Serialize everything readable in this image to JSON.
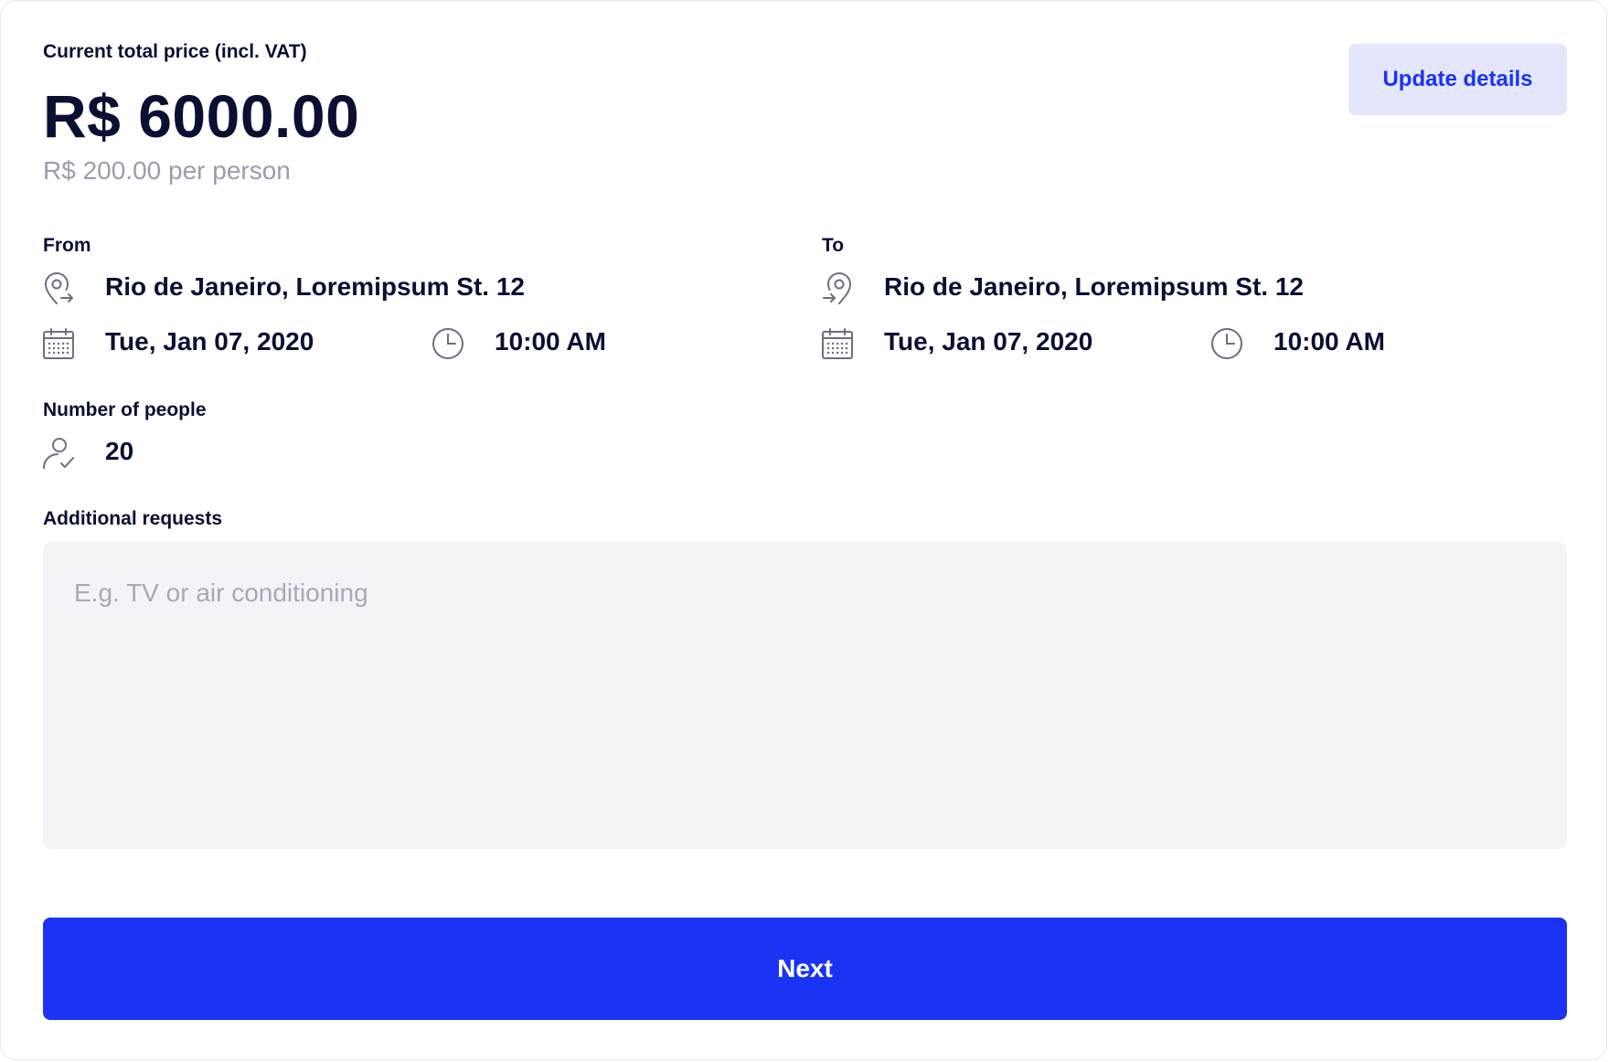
{
  "price": {
    "caption": "Current total price (incl. VAT)",
    "total": "R$ 6000.00",
    "per_person": "R$ 200.00 per person"
  },
  "update_button": "Update details",
  "from": {
    "label": "From",
    "address": "Rio de Janeiro, Loremipsum St. 12",
    "date": "Tue, Jan 07, 2020",
    "time": "10:00 AM"
  },
  "to": {
    "label": "To",
    "address": "Rio de Janeiro, Loremipsum St. 12",
    "date": "Tue, Jan 07, 2020",
    "time": "10:00 AM"
  },
  "people": {
    "label": "Number of people",
    "value": "20"
  },
  "requests": {
    "label": "Additional requests",
    "placeholder": "E.g. TV or air conditioning",
    "value": ""
  },
  "next_button": "Next",
  "colors": {
    "accent": "#1a33f5",
    "accent_light": "#e3e6fd",
    "text": "#0b1033",
    "muted": "#9a9dab",
    "field_bg": "#f3f4f7"
  },
  "icons": {
    "from": "map-pin-arrow-out-icon",
    "to": "map-pin-arrow-in-icon",
    "date": "calendar-icon",
    "time": "clock-icon",
    "people": "user-check-icon"
  }
}
